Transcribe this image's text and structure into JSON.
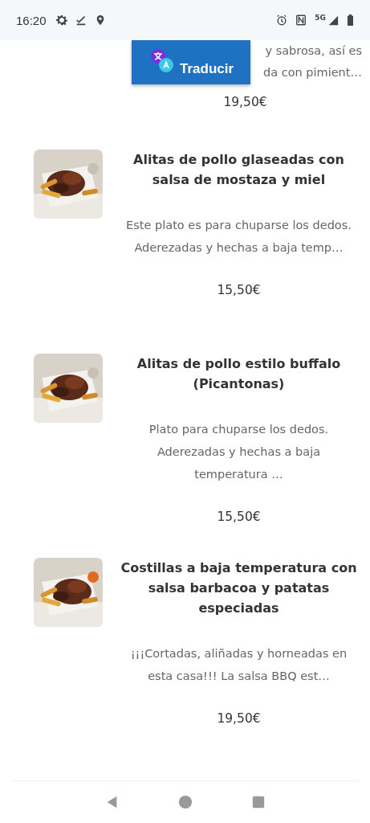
{
  "status_bar": {
    "time": "16:20",
    "network": "5G"
  },
  "translate_button": {
    "label": "Traducir"
  },
  "partial_item": {
    "description_lines": [
      "y sabrosa, así es",
      "da con pimient…"
    ],
    "price": "19,50€"
  },
  "items": [
    {
      "title": "Alitas de pollo glaseadas con salsa de mostaza y miel",
      "description": "Este plato es para chuparse los dedos. Aderezadas y hechas a baja temp…",
      "price": "15,50€"
    },
    {
      "title": "Alitas de pollo estilo buffalo (Picantonas)",
      "description": "Plato para chuparse los dedos. Aderezadas y hechas a baja temperatura …",
      "price": "15,50€"
    },
    {
      "title": "Costillas a baja temperatura con salsa barbacoa y patatas especiadas",
      "description": "¡¡¡Cortadas, aliñadas y horneadas en esta casa!!! La salsa BBQ est…",
      "price": "19,50€"
    }
  ]
}
